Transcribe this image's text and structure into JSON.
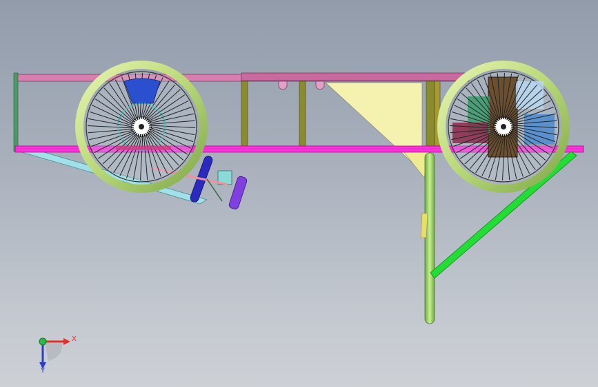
{
  "triad": {
    "x_label": "X",
    "y_label": "Y",
    "x_color": "#e0302a",
    "y_color": "#2a3fc8",
    "z_color": "#2ab84a",
    "icon": "coordinate-triad-icon"
  },
  "viewport": {
    "background_top": "#929cab",
    "background_bottom": "#cdd1d6"
  },
  "model": {
    "frame_rail_color": "#ff33dd",
    "top_rail_color": "#d87fb0",
    "post_color": "#8a8a30",
    "gusset_color": "#f5f2b0",
    "tire_color": "#c8e088",
    "tube_color": "#9ed868",
    "brace_color": "#22dd33"
  }
}
